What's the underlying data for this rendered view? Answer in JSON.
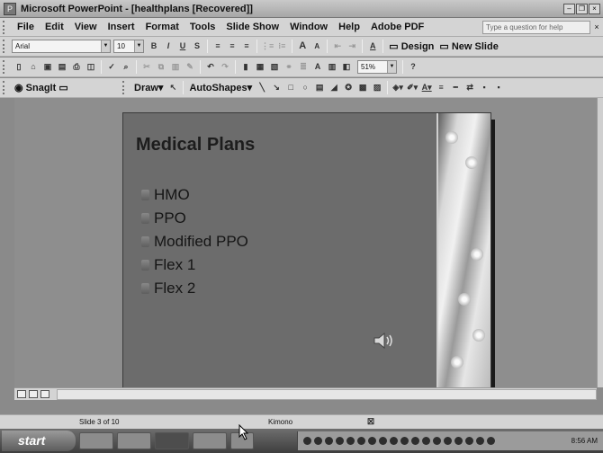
{
  "window": {
    "title": "Microsoft PowerPoint - [healthplans [Recovered]]",
    "app_icon": "powerpoint-icon",
    "controls": [
      "minimize-icon",
      "restore-icon",
      "close-icon"
    ]
  },
  "menubar": {
    "items": [
      {
        "label": "File",
        "underline": "F"
      },
      {
        "label": "Edit",
        "underline": "E"
      },
      {
        "label": "View",
        "underline": "V"
      },
      {
        "label": "Insert",
        "underline": "I"
      },
      {
        "label": "Format",
        "underline": "o"
      },
      {
        "label": "Tools",
        "underline": "T"
      },
      {
        "label": "Slide Show",
        "underline": "d"
      },
      {
        "label": "Window",
        "underline": "W"
      },
      {
        "label": "Help",
        "underline": "H"
      },
      {
        "label": "Adobe PDF",
        "underline": "b"
      }
    ],
    "ask_placeholder": "Type a question for help",
    "close_glyph": "×"
  },
  "formatting_toolbar": {
    "font": "Arial",
    "size": "10",
    "buttons": [
      "B",
      "I",
      "U",
      "S"
    ],
    "grow_font": "A",
    "shrink_font": "A",
    "font_color": "A",
    "design_label": "Design",
    "new_slide_label": "New Slide"
  },
  "standard_toolbar": {
    "zoom": "51%"
  },
  "drawing_toolbar": {
    "snagit_label": "SnagIt",
    "draw_label": "Draw",
    "autoshapes_label": "AutoShapes"
  },
  "slide": {
    "title": "Medical Plans",
    "bullets": [
      "HMO",
      "PPO",
      "Modified PPO",
      "Flex 1",
      "Flex 2"
    ],
    "sound_icon": "speaker-icon"
  },
  "status": {
    "slide_indicator": "Slide 3 of 10",
    "design_name": "Kimono",
    "language_icon": "spellcheck-icon"
  },
  "taskbar": {
    "start_label": "start",
    "tasks": [
      "",
      "",
      "",
      "",
      ""
    ],
    "clock": "8:56 AM"
  },
  "colors": {
    "slide_bg": "#6c6c6c",
    "workspace_bg": "#8e8e8e"
  }
}
